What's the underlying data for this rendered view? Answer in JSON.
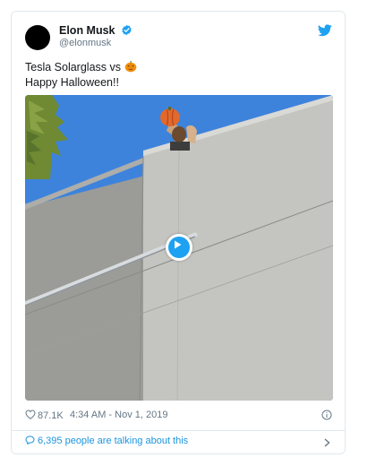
{
  "author": {
    "name": "Elon Musk",
    "handle": "@elonmusk",
    "verified": true,
    "avatar_icon": "avatar"
  },
  "tweet": {
    "line1": "Tesla Solarglass vs",
    "line1_emoji": "jack-o-lantern-icon",
    "line2": "Happy Halloween!!"
  },
  "media": {
    "type": "video",
    "play_icon": "play-icon"
  },
  "meta": {
    "likes": "87.1K",
    "timestamp": "4:34 AM - Nov 1, 2019"
  },
  "footer": {
    "talking": "6,395 people are talking about this"
  },
  "colors": {
    "brand": "#1da1f2",
    "link": "#1b95e0",
    "text": "#14171a",
    "secondary": "#657786",
    "border": "#e1e8ed"
  }
}
